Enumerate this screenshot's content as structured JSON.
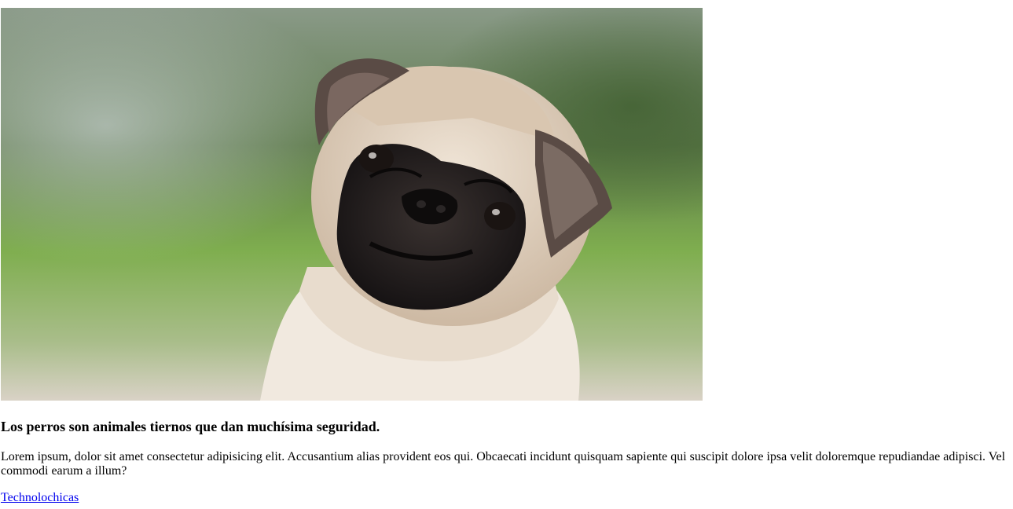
{
  "article": {
    "image": {
      "subject": "pug-photo",
      "colors": {
        "background_green": "#6f9a4c",
        "fawn_fur": "#e3d3c0",
        "black_mask": "#1e1a18"
      }
    },
    "heading": "Los perros son animales tiernos que dan muchísima seguridad.",
    "paragraph": "Lorem ipsum, dolor sit amet consectetur adipisicing elit. Accusantium alias provident eos qui. Obcaecati incidunt quisquam sapiente qui suscipit dolore ipsa velit doloremque repudiandae adipisci. Vel commodi earum a illum?",
    "link_text": "Technolochicas",
    "link_color": "#0000ee"
  }
}
